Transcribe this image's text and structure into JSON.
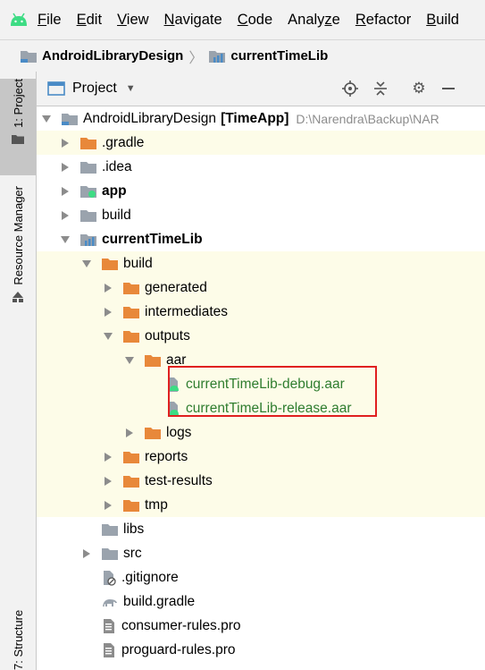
{
  "menu": [
    "File",
    "Edit",
    "View",
    "Navigate",
    "Code",
    "Analyze",
    "Refactor",
    "Build"
  ],
  "menu_mnemonics": [
    "F",
    "E",
    "V",
    "N",
    "C",
    "z",
    "R",
    "B"
  ],
  "breadcrumb": [
    "AndroidLibraryDesign",
    "currentTimeLib"
  ],
  "left_tabs": [
    "1: Project",
    "Resource Manager",
    "7: Structure"
  ],
  "panel": {
    "title": "Project"
  },
  "tree": {
    "root": {
      "name": "AndroidLibraryDesign",
      "module": "[TimeApp]",
      "path": "D:\\Narendra\\Backup\\NAR"
    },
    "gradle": ".gradle",
    "idea": ".idea",
    "app": "app",
    "build_root": "build",
    "lib": "currentTimeLib",
    "lib_build": "build",
    "generated": "generated",
    "intermediates": "intermediates",
    "outputs": "outputs",
    "aar": "aar",
    "aar_debug": "currentTimeLib-debug.aar",
    "aar_release": "currentTimeLib-release.aar",
    "logs": "logs",
    "reports": "reports",
    "test_results": "test-results",
    "tmp": "tmp",
    "libs": "libs",
    "src": "src",
    "gitignore": ".gitignore",
    "build_gradle": "build.gradle",
    "consumer_rules": "consumer-rules.pro",
    "proguard_rules": "proguard-rules.pro"
  },
  "colors": {
    "excluded_folder": "#e8883a",
    "normal_folder": "#9aa3ad",
    "module": "#4a8bc6",
    "highlight": "#fdfce8",
    "callout_border": "#e02020",
    "android_green": "#3ddc84"
  }
}
